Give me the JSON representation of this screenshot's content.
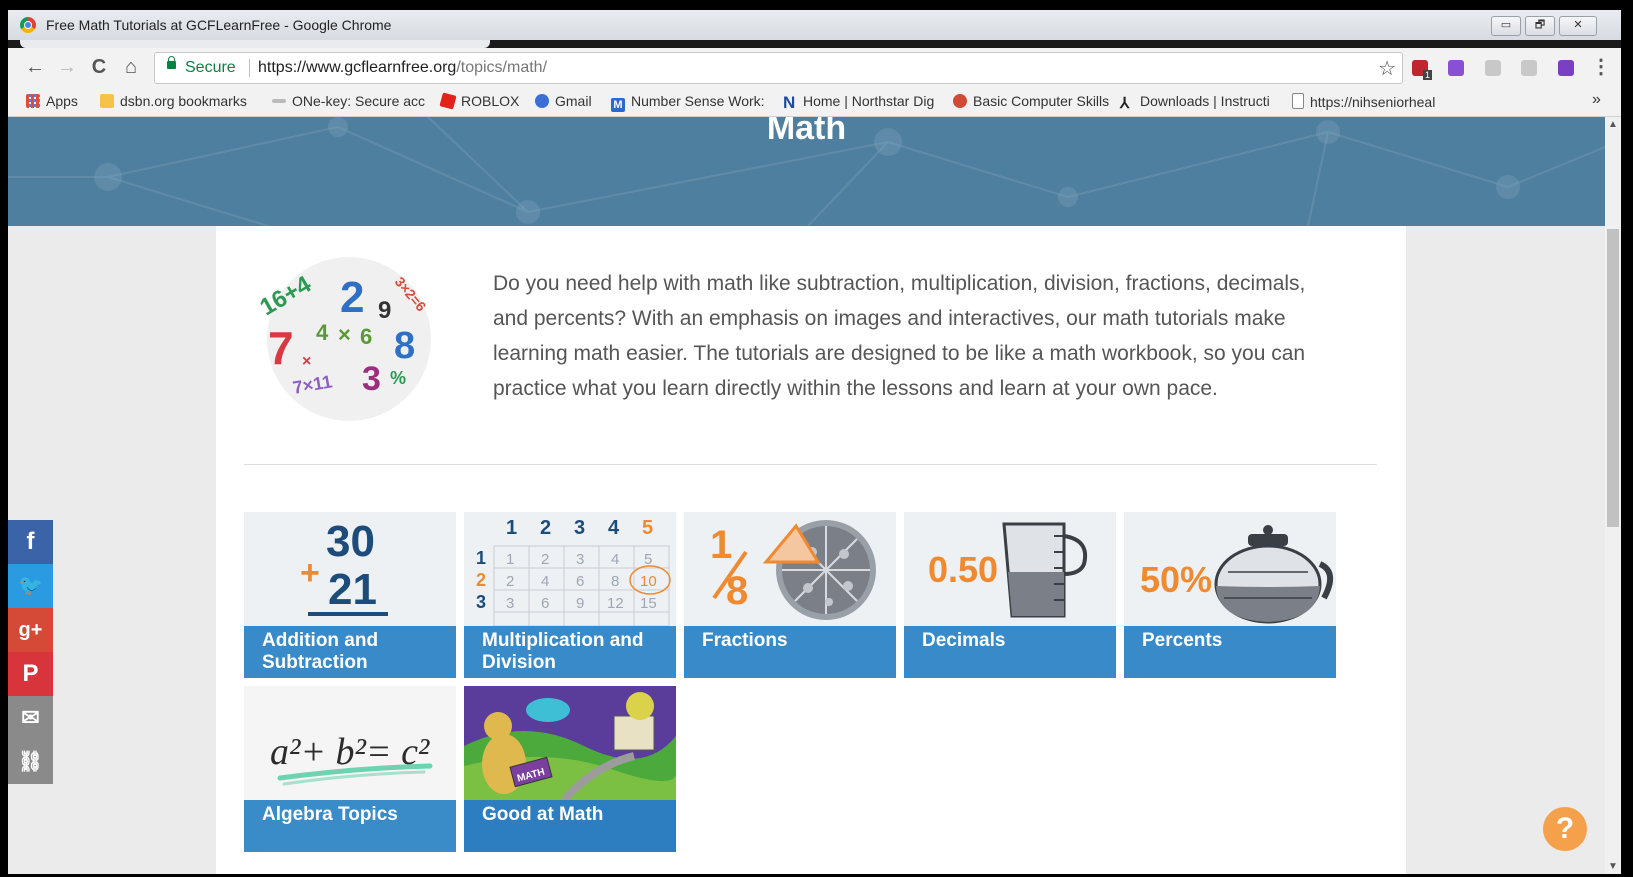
{
  "window": {
    "title": "Free Math Tutorials at GCFLearnFree - Google Chrome",
    "controls": {
      "minimize": "▭",
      "restore": "🗗",
      "close": "✕"
    }
  },
  "toolbar": {
    "back": "←",
    "forward": "→",
    "reload": "C",
    "home": "⌂",
    "secure_label": "Secure",
    "url_host": "https://www.gcflearnfree.org",
    "url_path": "/topics/math/",
    "star": "☆",
    "ext_badge": "1",
    "menu": "⋮"
  },
  "bookmarks": {
    "items": [
      {
        "label": "Apps",
        "icon": "apps-grid-icon",
        "color": "#e54b36"
      },
      {
        "label": "dsbn.org bookmarks",
        "icon": "folder-icon",
        "color": "#f3c34a"
      },
      {
        "label": "ONe-key: Secure acc",
        "icon": "key-icon",
        "color": "#666666"
      },
      {
        "label": "ROBLOX",
        "icon": "roblox-icon",
        "color": "#e2231a"
      },
      {
        "label": "Gmail",
        "icon": "gmail-icon",
        "color": "#3b6fd6"
      },
      {
        "label": "Number Sense Work:",
        "icon": "m-icon",
        "color": "#2a6bd1"
      },
      {
        "label": "Home | Northstar Dig",
        "icon": "northstar-icon",
        "color": "#1f4a9c"
      },
      {
        "label": "Basic Computer Skills",
        "icon": "computer-icon",
        "color": "#d04a36"
      },
      {
        "label": "Downloads | Instructi",
        "icon": "person-icon",
        "color": "#222222"
      },
      {
        "label": "https://nihseniorheal",
        "icon": "page-icon",
        "color": "#888888"
      }
    ],
    "more": "»"
  },
  "hero": {
    "title": "Math"
  },
  "intro": {
    "text": "Do you need help with math like subtraction, multiplication, division, fractions, decimals, and percents? With an emphasis on images and interactives, our math tutorials make learning math easier. The tutorials are designed to be like a math workbook, so you can practice what you learn directly within the lessons and learn at your own pace."
  },
  "numbers_art": [
    "16+4",
    "2",
    "9",
    "3×2=6",
    "7",
    "×",
    "4",
    "×",
    "6",
    "8",
    "7×11",
    "3",
    "%"
  ],
  "topics": [
    {
      "label_1": "Addition and",
      "label_2": "Subtraction",
      "art": {
        "top": "30",
        "op": "+",
        "bottom": "21"
      }
    },
    {
      "label_1": "Multiplication and",
      "label_2": "Division",
      "art": {
        "head": [
          "1",
          "2",
          "3",
          "4",
          "5"
        ],
        "rows": [
          [
            "1",
            "1",
            "2",
            "3",
            "4",
            "5"
          ],
          [
            "2",
            "2",
            "4",
            "6",
            "8",
            "10"
          ],
          [
            "3",
            "3",
            "6",
            "9",
            "12",
            "15"
          ]
        ]
      }
    },
    {
      "label_1": "Fractions",
      "label_2": "",
      "art": {
        "num": "1",
        "den": "8"
      }
    },
    {
      "label_1": "Decimals",
      "label_2": "",
      "art": {
        "value": "0.50"
      }
    },
    {
      "label_1": "Percents",
      "label_2": "",
      "art": {
        "value": "50%"
      }
    },
    {
      "label_1": "Algebra Topics",
      "label_2": "",
      "art": {
        "eq": "a²+ b²= c²"
      }
    },
    {
      "label_1": "Good at Math",
      "label_2": "",
      "art": {
        "sign": "MATH"
      }
    }
  ],
  "social": [
    {
      "glyph": "f",
      "icon": "facebook-icon",
      "color": "#3b63a8"
    },
    {
      "glyph": "🐦",
      "icon": "twitter-icon",
      "color": "#2a9be0"
    },
    {
      "glyph": "g+",
      "icon": "google-plus-icon",
      "color": "#d54a36"
    },
    {
      "glyph": "P",
      "icon": "pinterest-icon",
      "color": "#d8343c"
    },
    {
      "glyph": "✉",
      "icon": "email-icon",
      "color": "#8a8a8a"
    },
    {
      "glyph": "⛓",
      "icon": "link-icon",
      "color": "#8a8a8a"
    }
  ],
  "help": {
    "glyph": "?"
  },
  "scrollbar": {
    "up": "▲",
    "down": "▼"
  },
  "colors": {
    "hero": "#4f7f9e",
    "tile_label": "#2882c3",
    "accent": "#f08a30"
  }
}
